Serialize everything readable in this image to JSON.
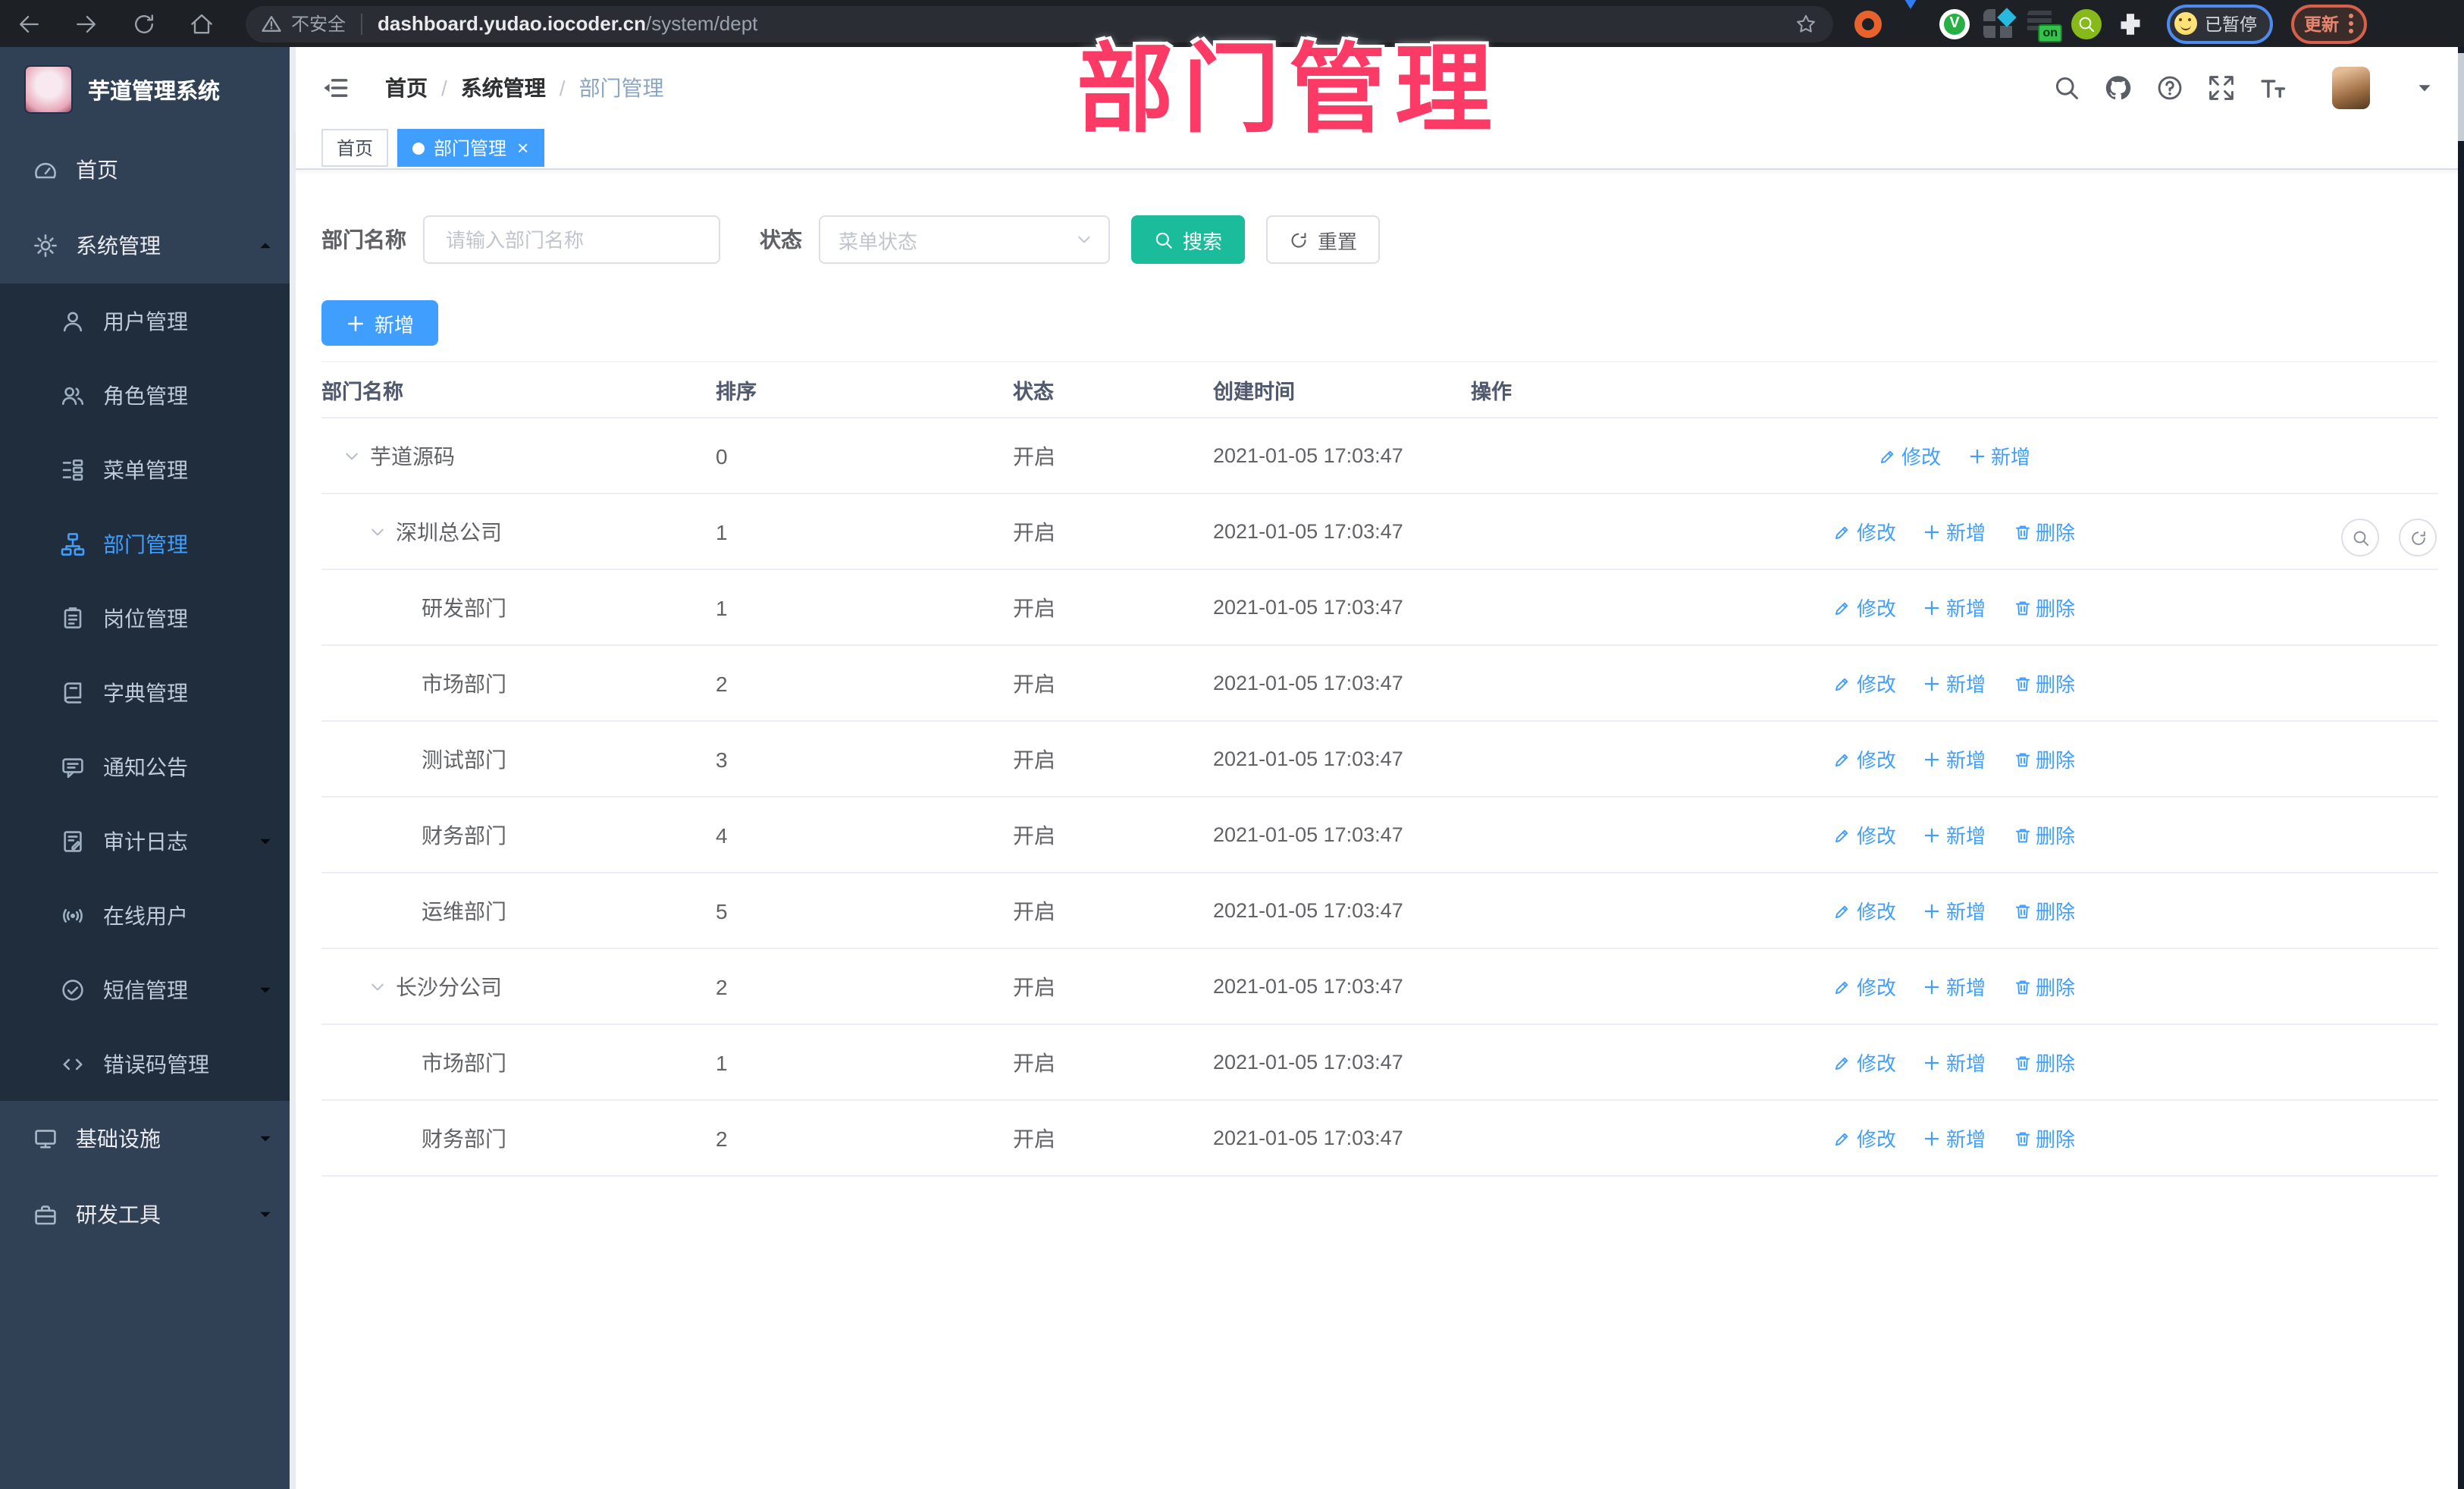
{
  "browser": {
    "security_label": "不安全",
    "url_host": "dashboard.yudao.iocoder.cn",
    "url_path": "/system/dept",
    "profile_status_label": "已暂停",
    "update_label": "更新"
  },
  "overlay_title": "部门管理",
  "colors": {
    "accent": "#409eff",
    "search_button": "#1abc9c",
    "overlay_pink": "#fb3a66",
    "sidebar_bg": "#304156",
    "submenu_bg": "#1f2d3d"
  },
  "sidebar": {
    "app_title": "芋道管理系统",
    "items": [
      {
        "label": "首页",
        "icon": "dashboard",
        "type": "top"
      },
      {
        "label": "系统管理",
        "icon": "gear",
        "type": "top",
        "arrow": "up"
      },
      {
        "label": "用户管理",
        "icon": "user",
        "type": "sub"
      },
      {
        "label": "角色管理",
        "icon": "users",
        "type": "sub"
      },
      {
        "label": "菜单管理",
        "icon": "treetable",
        "type": "sub"
      },
      {
        "label": "部门管理",
        "icon": "tree",
        "type": "sub",
        "active": true
      },
      {
        "label": "岗位管理",
        "icon": "post",
        "type": "sub"
      },
      {
        "label": "字典管理",
        "icon": "dict",
        "type": "sub"
      },
      {
        "label": "通知公告",
        "icon": "message",
        "type": "sub"
      },
      {
        "label": "审计日志",
        "icon": "log",
        "type": "sub",
        "arrow": "down"
      },
      {
        "label": "在线用户",
        "icon": "online",
        "type": "sub"
      },
      {
        "label": "短信管理",
        "icon": "sms",
        "type": "sub",
        "arrow": "down"
      },
      {
        "label": "错误码管理",
        "icon": "code",
        "type": "sub"
      },
      {
        "label": "基础设施",
        "icon": "monitor",
        "type": "top",
        "arrow": "down"
      },
      {
        "label": "研发工具",
        "icon": "toolbox",
        "type": "top",
        "arrow": "down"
      }
    ]
  },
  "header": {
    "breadcrumb": [
      "首页",
      "系统管理",
      "部门管理"
    ]
  },
  "tabs": [
    {
      "label": "首页",
      "active": false,
      "closable": false
    },
    {
      "label": "部门管理",
      "active": true,
      "closable": true
    }
  ],
  "filters": {
    "dept_label": "部门名称",
    "dept_placeholder": "请输入部门名称",
    "status_label": "状态",
    "status_placeholder": "菜单状态",
    "search_label": "搜索",
    "reset_label": "重置"
  },
  "toolbar": {
    "add_label": "新增"
  },
  "actions": {
    "modify": "修改",
    "add": "新增",
    "delete": "删除"
  },
  "table": {
    "columns": [
      "部门名称",
      "排序",
      "状态",
      "创建时间",
      "操作"
    ],
    "rows": [
      {
        "name": "芋道源码",
        "level": 0,
        "caret": true,
        "sort": "0",
        "status": "开启",
        "time": "2021-01-05 17:03:47",
        "actions": [
          "modify",
          "add"
        ]
      },
      {
        "name": "深圳总公司",
        "level": 1,
        "caret": true,
        "sort": "1",
        "status": "开启",
        "time": "2021-01-05 17:03:47",
        "actions": [
          "modify",
          "add",
          "delete"
        ]
      },
      {
        "name": "研发部门",
        "level": 2,
        "caret": false,
        "sort": "1",
        "status": "开启",
        "time": "2021-01-05 17:03:47",
        "actions": [
          "modify",
          "add",
          "delete"
        ]
      },
      {
        "name": "市场部门",
        "level": 2,
        "caret": false,
        "sort": "2",
        "status": "开启",
        "time": "2021-01-05 17:03:47",
        "actions": [
          "modify",
          "add",
          "delete"
        ]
      },
      {
        "name": "测试部门",
        "level": 2,
        "caret": false,
        "sort": "3",
        "status": "开启",
        "time": "2021-01-05 17:03:47",
        "actions": [
          "modify",
          "add",
          "delete"
        ]
      },
      {
        "name": "财务部门",
        "level": 2,
        "caret": false,
        "sort": "4",
        "status": "开启",
        "time": "2021-01-05 17:03:47",
        "actions": [
          "modify",
          "add",
          "delete"
        ]
      },
      {
        "name": "运维部门",
        "level": 2,
        "caret": false,
        "sort": "5",
        "status": "开启",
        "time": "2021-01-05 17:03:47",
        "actions": [
          "modify",
          "add",
          "delete"
        ]
      },
      {
        "name": "长沙分公司",
        "level": 1,
        "caret": true,
        "sort": "2",
        "status": "开启",
        "time": "2021-01-05 17:03:47",
        "actions": [
          "modify",
          "add",
          "delete"
        ]
      },
      {
        "name": "市场部门",
        "level": 2,
        "caret": false,
        "sort": "1",
        "status": "开启",
        "time": "2021-01-05 17:03:47",
        "actions": [
          "modify",
          "add",
          "delete"
        ]
      },
      {
        "name": "财务部门",
        "level": 2,
        "caret": false,
        "sort": "2",
        "status": "开启",
        "time": "2021-01-05 17:03:47",
        "actions": [
          "modify",
          "add",
          "delete"
        ]
      }
    ]
  }
}
